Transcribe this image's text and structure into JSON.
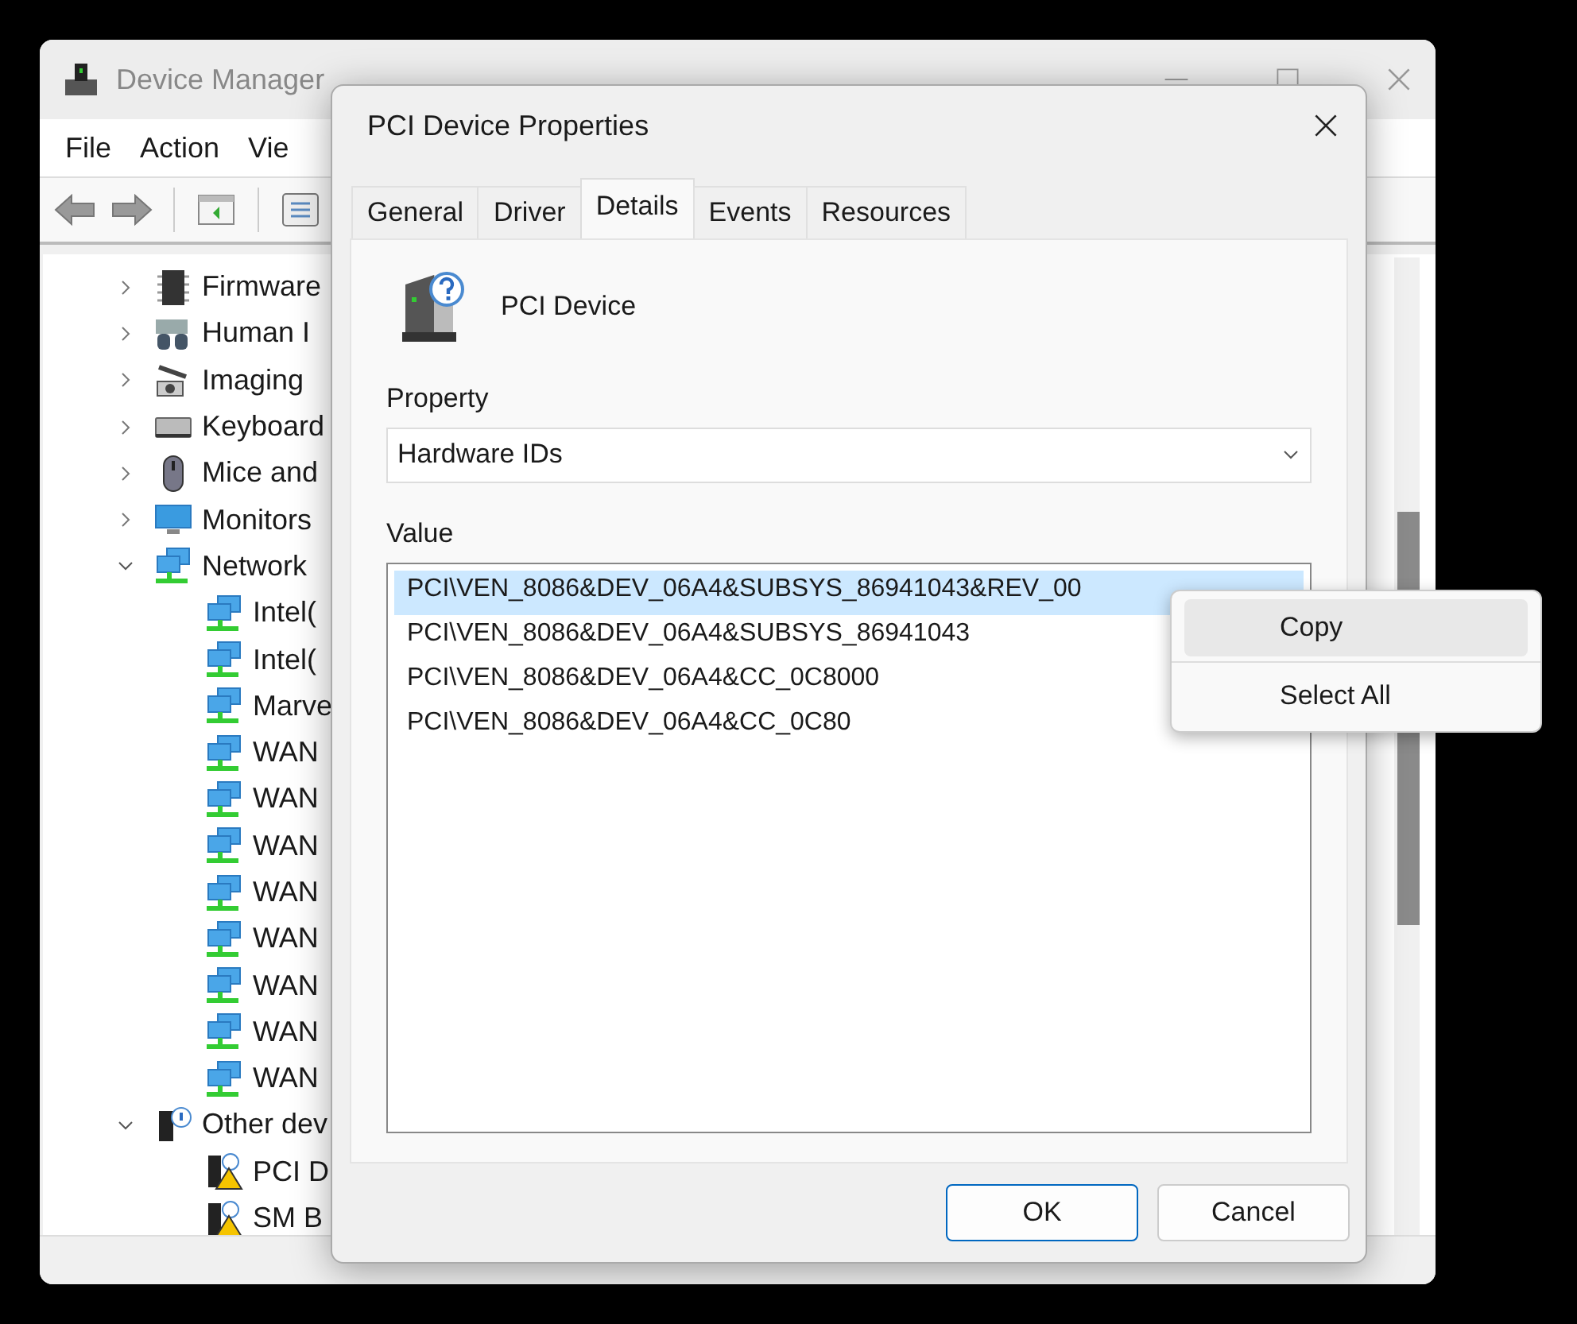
{
  "main_window": {
    "title": "Device Manager",
    "menu": [
      "File",
      "Action",
      "Vie"
    ],
    "tree": [
      {
        "label": "Firmware",
        "kind": "chip",
        "expanded": false
      },
      {
        "label": "Human I",
        "kind": "hid",
        "expanded": false
      },
      {
        "label": "Imaging",
        "kind": "camera",
        "expanded": false
      },
      {
        "label": "Keyboard",
        "kind": "keyboard",
        "expanded": false
      },
      {
        "label": "Mice and",
        "kind": "mouse",
        "expanded": false
      },
      {
        "label": "Monitors",
        "kind": "monitor",
        "expanded": false
      },
      {
        "label": "Network",
        "kind": "network",
        "expanded": true,
        "children": [
          {
            "label": "Intel(",
            "kind": "network"
          },
          {
            "label": "Intel(",
            "kind": "network"
          },
          {
            "label": "Marve",
            "kind": "network"
          },
          {
            "label": "WAN",
            "kind": "network"
          },
          {
            "label": "WAN",
            "kind": "network"
          },
          {
            "label": "WAN",
            "kind": "network"
          },
          {
            "label": "WAN",
            "kind": "network"
          },
          {
            "label": "WAN",
            "kind": "network"
          },
          {
            "label": "WAN",
            "kind": "network"
          },
          {
            "label": "WAN",
            "kind": "network"
          },
          {
            "label": "WAN",
            "kind": "network"
          }
        ]
      },
      {
        "label": "Other dev",
        "kind": "other",
        "expanded": true,
        "children": [
          {
            "label": "PCI D",
            "kind": "warning"
          },
          {
            "label": "SM B",
            "kind": "warning"
          }
        ]
      }
    ]
  },
  "dialog": {
    "title": "PCI Device Properties",
    "tabs": [
      {
        "label": "General",
        "selected": false
      },
      {
        "label": "Driver",
        "selected": false
      },
      {
        "label": "Details",
        "selected": true
      },
      {
        "label": "Events",
        "selected": false
      },
      {
        "label": "Resources",
        "selected": false
      }
    ],
    "device_name": "PCI Device",
    "property_label": "Property",
    "property_value": "Hardware IDs",
    "value_label": "Value",
    "values": [
      {
        "text": "PCI\\VEN_8086&DEV_06A4&SUBSYS_86941043&REV_00",
        "selected": true
      },
      {
        "text": "PCI\\VEN_8086&DEV_06A4&SUBSYS_86941043",
        "selected": false
      },
      {
        "text": "PCI\\VEN_8086&DEV_06A4&CC_0C8000",
        "selected": false
      },
      {
        "text": "PCI\\VEN_8086&DEV_06A4&CC_0C80",
        "selected": false
      }
    ],
    "buttons": [
      "OK",
      "Cancel"
    ]
  },
  "context_menu": [
    {
      "label": "Copy",
      "selected": true
    },
    {
      "label": "Select All",
      "selected": false
    }
  ]
}
